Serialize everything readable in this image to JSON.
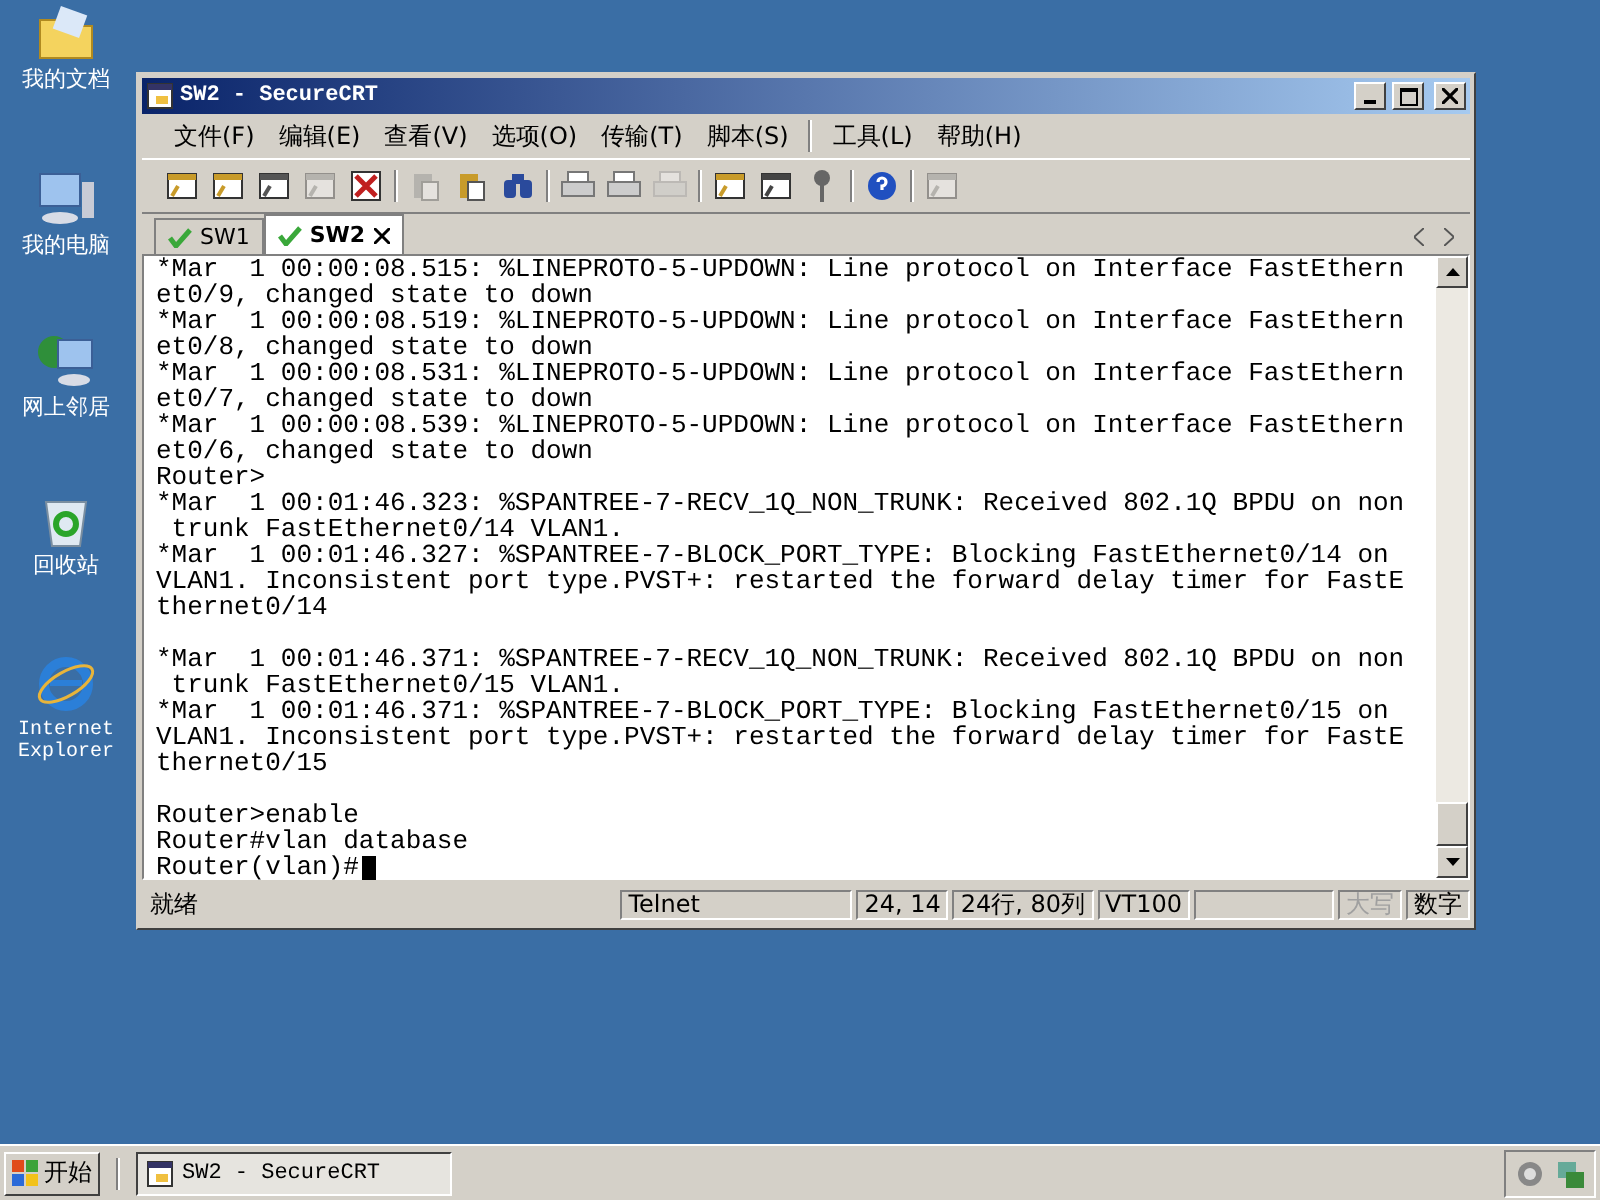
{
  "desktop_icons": [
    {
      "kind": "documents",
      "label": "我的文档"
    },
    {
      "kind": "computer",
      "label": "我的电脑"
    },
    {
      "kind": "network",
      "label": "网上邻居"
    },
    {
      "kind": "recycle",
      "label": "回收站"
    },
    {
      "kind": "browser",
      "label": "Internet Explorer"
    }
  ],
  "window": {
    "title": "SW2 - SecureCRT",
    "menu": [
      {
        "label": "文件(F)"
      },
      {
        "label": "编辑(E)"
      },
      {
        "label": "查看(V)"
      },
      {
        "label": "选项(O)"
      },
      {
        "label": "传输(T)"
      },
      {
        "label": "脚本(S)",
        "separator_after": true
      },
      {
        "label": "工具(L)"
      },
      {
        "label": "帮助(H)"
      }
    ],
    "toolbar": [
      [
        {
          "kind": "connect",
          "disabled": false
        },
        {
          "kind": "quick-connect",
          "disabled": false
        },
        {
          "kind": "connect-tab",
          "disabled": false
        },
        {
          "kind": "reconnect",
          "disabled": true
        },
        {
          "kind": "disconnect",
          "disabled": false
        }
      ],
      [
        {
          "kind": "copy",
          "disabled": true
        },
        {
          "kind": "paste",
          "disabled": false
        },
        {
          "kind": "find",
          "disabled": false
        }
      ],
      [
        {
          "kind": "print",
          "disabled": false
        },
        {
          "kind": "print-selection",
          "disabled": false
        },
        {
          "kind": "printer",
          "disabled": true
        }
      ],
      [
        {
          "kind": "session-options",
          "disabled": false
        },
        {
          "kind": "global-options",
          "disabled": false
        },
        {
          "kind": "key",
          "disabled": false
        }
      ],
      [
        {
          "kind": "help",
          "disabled": false
        }
      ],
      [
        {
          "kind": "sftp",
          "disabled": true
        }
      ]
    ],
    "tabs": [
      {
        "label": "SW1",
        "selected": false
      },
      {
        "label": "SW2",
        "selected": true
      }
    ],
    "terminal": {
      "blocks": [
        [
          "*Mar  1 00:00:08.515: %LINEPROTO-5-UPDOWN: Line protocol on Interface FastEthern",
          "et0/9, changed state to down",
          "*Mar  1 00:00:08.519: %LINEPROTO-5-UPDOWN: Line protocol on Interface FastEthern",
          "et0/8, changed state to down",
          "*Mar  1 00:00:08.531: %LINEPROTO-5-UPDOWN: Line protocol on Interface FastEthern",
          "et0/7, changed state to down",
          "*Mar  1 00:00:08.539: %LINEPROTO-5-UPDOWN: Line protocol on Interface FastEthern",
          "et0/6, changed state to down",
          "Router>",
          "*Mar  1 00:01:46.323: %SPANTREE-7-RECV_1Q_NON_TRUNK: Received 802.1Q BPDU on non",
          " trunk FastEthernet0/14 VLAN1.",
          "*Mar  1 00:01:46.327: %SPANTREE-7-BLOCK_PORT_TYPE: Blocking FastEthernet0/14 on",
          "VLAN1. Inconsistent port type.PVST+: restarted the forward delay timer for FastE",
          "thernet0/14"
        ],
        [
          "*Mar  1 00:01:46.371: %SPANTREE-7-RECV_1Q_NON_TRUNK: Received 802.1Q BPDU on non",
          " trunk FastEthernet0/15 VLAN1.",
          "*Mar  1 00:01:46.371: %SPANTREE-7-BLOCK_PORT_TYPE: Blocking FastEthernet0/15 on",
          "VLAN1. Inconsistent port type.PVST+: restarted the forward delay timer for FastE",
          "thernet0/15"
        ],
        [
          "Router>enable",
          "Router#vlan database",
          "Router(vlan)#"
        ]
      ],
      "cursor_visible": true
    },
    "status_bar": {
      "message": "就绪",
      "panels": [
        {
          "text": "Telnet",
          "disabled": false
        },
        {
          "text": "24, 14",
          "disabled": false
        },
        {
          "text": "24行, 80列",
          "disabled": false
        },
        {
          "text": "VT100",
          "disabled": false
        },
        {
          "text": "大写",
          "disabled": true
        },
        {
          "text": "数字",
          "disabled": false
        }
      ]
    }
  },
  "taskbar": {
    "start_label": "开始",
    "tasks": [
      {
        "label": "SW2 - SecureCRT",
        "selected": true
      }
    ]
  }
}
